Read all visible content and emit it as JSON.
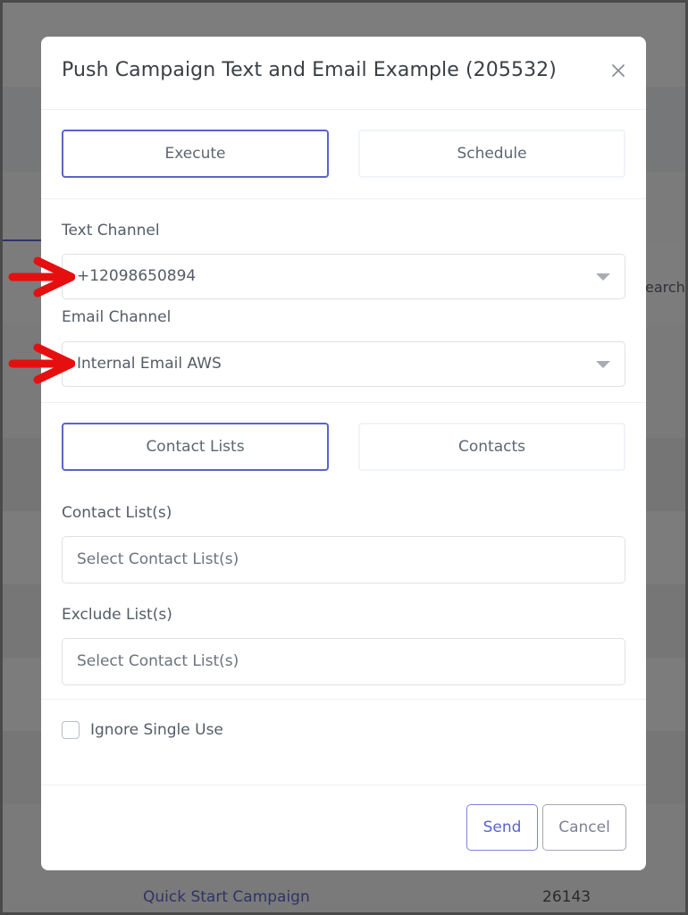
{
  "background": {
    "search_fragment": "earch",
    "row_link": "Quick Start Campaign",
    "row_number": "26143"
  },
  "modal": {
    "title": "Push Campaign Text and Email Example (205532)",
    "close_icon": "close-icon",
    "mode_tabs": [
      {
        "label": "Execute",
        "active": true
      },
      {
        "label": "Schedule",
        "active": false
      }
    ],
    "text_channel": {
      "label": "Text Channel",
      "value": "+12098650894"
    },
    "email_channel": {
      "label": "Email Channel",
      "value": "Internal Email AWS"
    },
    "recipient_tabs": [
      {
        "label": "Contact Lists",
        "active": true
      },
      {
        "label": "Contacts",
        "active": false
      }
    ],
    "contact_lists": {
      "label": "Contact List(s)",
      "placeholder": "Select Contact List(s)"
    },
    "exclude_lists": {
      "label": "Exclude List(s)",
      "placeholder": "Select Contact List(s)"
    },
    "ignore_single_use": {
      "label": "Ignore Single Use",
      "checked": false
    },
    "footer": {
      "send_label": "Send",
      "cancel_label": "Cancel"
    }
  },
  "annotations": {
    "arrow_color": "#e60f0f",
    "targets": [
      "text-channel-select",
      "email-channel-select"
    ]
  },
  "colors": {
    "accent": "#5a64c8",
    "overlay": "#7a7a7a"
  }
}
